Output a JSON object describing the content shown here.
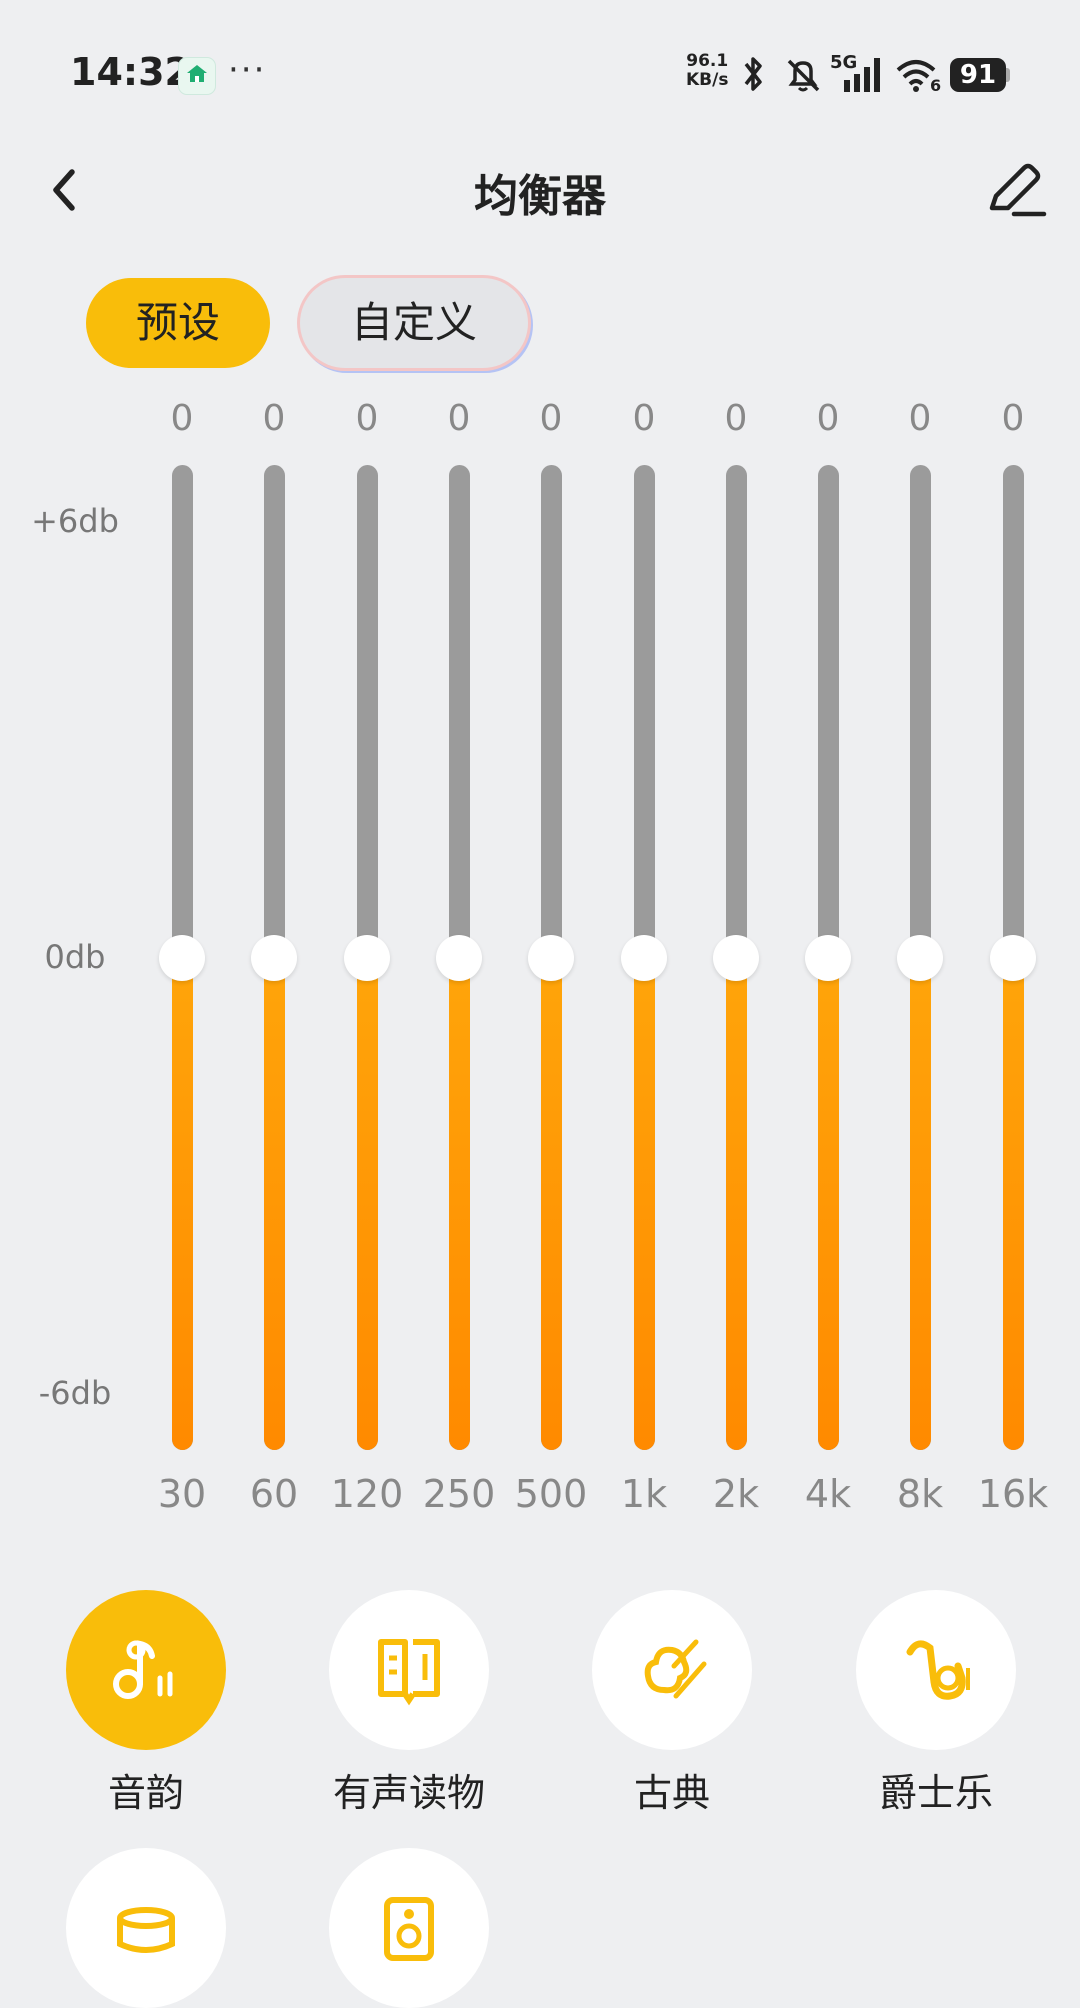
{
  "status_bar": {
    "time": "14:32",
    "more": "···",
    "net_speed_value": "96.1",
    "net_speed_unit": "KB/s",
    "network_type": "5G",
    "wifi_sub": "6",
    "battery": "91"
  },
  "header": {
    "title": "均衡器"
  },
  "tabs": {
    "preset": "预设",
    "custom": "自定义"
  },
  "db_scale": {
    "top": "+6db",
    "mid": "0db",
    "bottom": "-6db"
  },
  "bands": [
    {
      "freq": "30",
      "value": "0",
      "level_db": 0
    },
    {
      "freq": "60",
      "value": "0",
      "level_db": 0
    },
    {
      "freq": "120",
      "value": "0",
      "level_db": 0
    },
    {
      "freq": "250",
      "value": "0",
      "level_db": 0
    },
    {
      "freq": "500",
      "value": "0",
      "level_db": 0
    },
    {
      "freq": "1k",
      "value": "0",
      "level_db": 0
    },
    {
      "freq": "2k",
      "value": "0",
      "level_db": 0
    },
    {
      "freq": "4k",
      "value": "0",
      "level_db": 0
    },
    {
      "freq": "8k",
      "value": "0",
      "level_db": 0
    },
    {
      "freq": "16k",
      "value": "0",
      "level_db": 0
    }
  ],
  "presets": [
    {
      "label": "音韵",
      "icon": "music-note-icon",
      "active": true
    },
    {
      "label": "有声读物",
      "icon": "open-book-icon",
      "active": false
    },
    {
      "label": "古典",
      "icon": "violin-icon",
      "active": false
    },
    {
      "label": "爵士乐",
      "icon": "saxophone-icon",
      "active": false
    },
    {
      "label": "",
      "icon": "drum-icon",
      "active": false
    },
    {
      "label": "",
      "icon": "speaker-icon",
      "active": false
    }
  ],
  "colors": {
    "accent": "#f9bd0a",
    "fill": "#ff9a00",
    "track": "#9b9b9b",
    "background": "#eeeff1"
  }
}
